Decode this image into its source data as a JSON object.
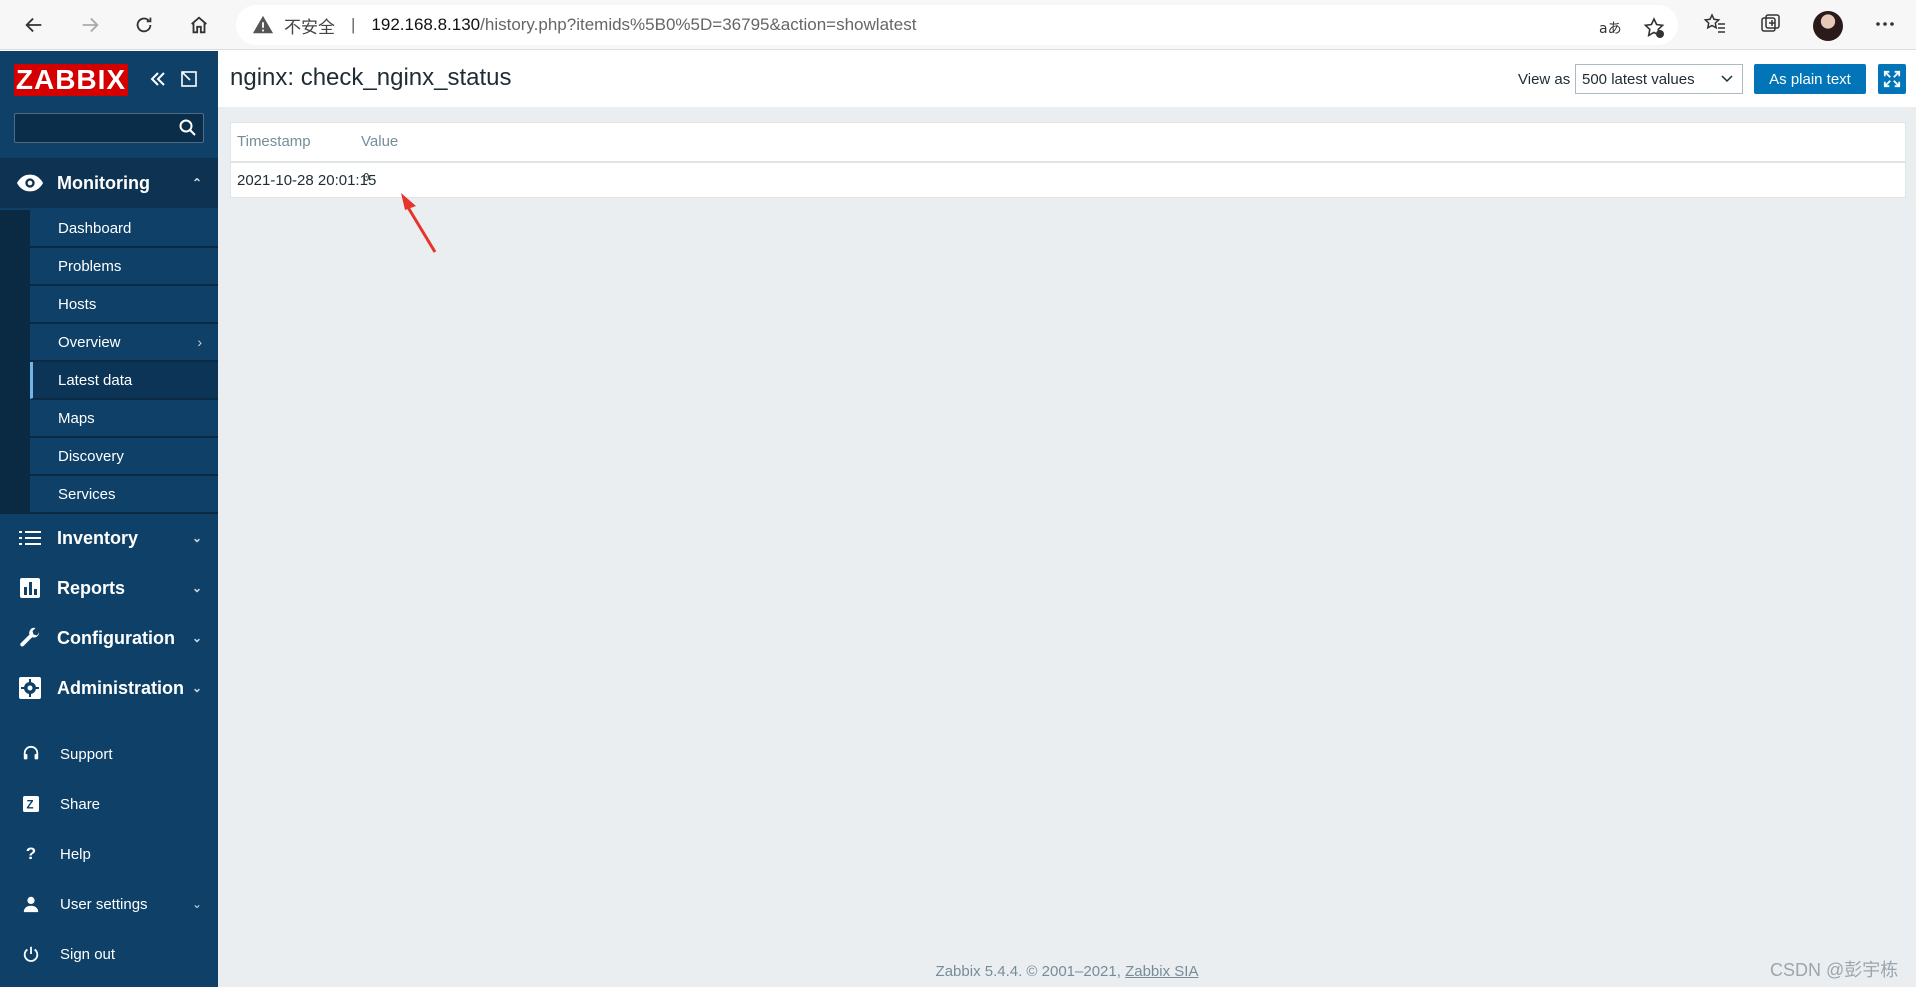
{
  "browser": {
    "insecure_label": "不安全",
    "separator": "|",
    "url_host": "192.168.8.130",
    "url_path": "/history.php?itemids%5B0%5D=36795&action=showlatest"
  },
  "sidebar": {
    "logo": "ZABBIX",
    "search_placeholder": "",
    "monitoring": {
      "label": "Monitoring",
      "items": [
        {
          "label": "Dashboard"
        },
        {
          "label": "Problems"
        },
        {
          "label": "Hosts"
        },
        {
          "label": "Overview"
        },
        {
          "label": "Latest data"
        },
        {
          "label": "Maps"
        },
        {
          "label": "Discovery"
        },
        {
          "label": "Services"
        }
      ]
    },
    "sections": [
      {
        "label": "Inventory"
      },
      {
        "label": "Reports"
      },
      {
        "label": "Configuration"
      },
      {
        "label": "Administration"
      }
    ],
    "bottom": [
      {
        "label": "Support"
      },
      {
        "label": "Share"
      },
      {
        "label": "Help"
      },
      {
        "label": "User settings"
      },
      {
        "label": "Sign out"
      }
    ]
  },
  "header": {
    "title": "nginx: check_nginx_status",
    "view_as_label": "View as",
    "view_as_value": "500 latest values",
    "plain_text_button": "As plain text"
  },
  "table": {
    "columns": [
      "Timestamp",
      "Value"
    ],
    "rows": [
      {
        "timestamp": "2021-10-28 20:01:15",
        "value": "0"
      }
    ]
  },
  "footer": {
    "text": "Zabbix 5.4.4. © 2001–2021,",
    "link": "Zabbix SIA"
  },
  "watermark": "CSDN @彭宇栋",
  "colors": {
    "sidebar_bg": "#0e4068",
    "logo_red": "#d40000",
    "primary_button": "#0275b8",
    "main_bg": "#ebeef0",
    "annotation_arrow": "#e8332a"
  }
}
